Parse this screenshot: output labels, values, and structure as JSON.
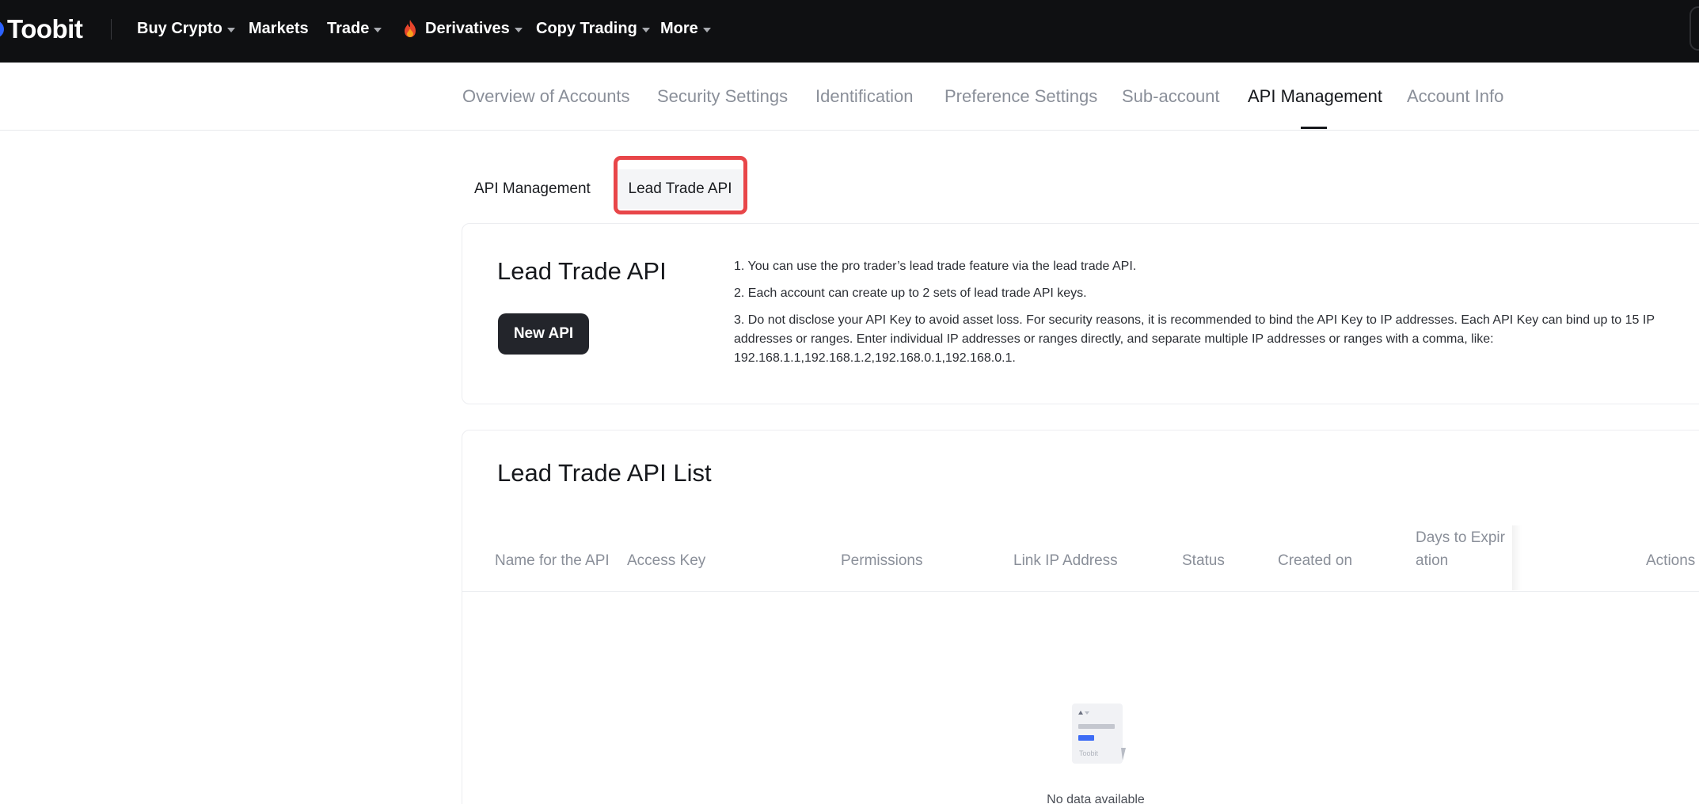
{
  "brand": {
    "name": "Toobit",
    "accent": "#2c62ff"
  },
  "topnav": {
    "items": [
      {
        "label": "Buy Crypto",
        "dropdown": true
      },
      {
        "label": "Markets",
        "dropdown": false
      },
      {
        "label": "Trade",
        "dropdown": true
      },
      {
        "label": "Derivatives",
        "dropdown": true,
        "icon": "fire-icon"
      },
      {
        "label": "Copy Trading",
        "dropdown": true
      },
      {
        "label": "More",
        "dropdown": true
      }
    ]
  },
  "account_tabs": {
    "items": [
      {
        "label": "Overview of Accounts"
      },
      {
        "label": "Security Settings"
      },
      {
        "label": "Identification"
      },
      {
        "label": "Preference Settings"
      },
      {
        "label": "Sub-account"
      },
      {
        "label": "API Management",
        "active": true
      },
      {
        "label": "Account Info"
      }
    ]
  },
  "sub_tabs": {
    "items": [
      {
        "label": "API Management"
      },
      {
        "label": "Lead Trade API",
        "selected": true
      }
    ],
    "highlight_color": "#e84649"
  },
  "lead_trade": {
    "title": "Lead Trade API",
    "new_button": "New API",
    "notes": [
      "1. You can use the pro trader’s lead trade feature via the lead trade API.",
      "2. Each account can create up to 2 sets of lead trade API keys.",
      "3. Do not disclose your API Key to avoid asset loss. For security reasons, it is recommended to bind the API Key to IP addresses. Each API Key can bind up to 15 IP addresses or ranges. Enter individual IP addresses or ranges directly, and separate multiple IP addresses or ranges with a comma, like: 192.168.1.1,192.168.1.2,192.168.0.1,192.168.0.1."
    ]
  },
  "api_list": {
    "title": "Lead Trade API List",
    "columns": [
      "Name for the API",
      "Access Key",
      "Permissions",
      "Link IP Address",
      "Status",
      "Created on",
      "Days to Expiration",
      "Actions"
    ],
    "rows": [],
    "empty_text": "No data available",
    "empty_icon_label": "Toobit"
  }
}
